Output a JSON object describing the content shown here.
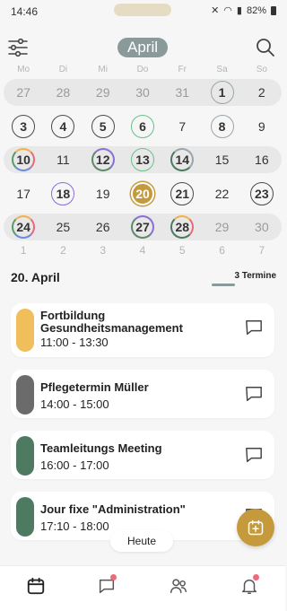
{
  "status": {
    "time": "14:46",
    "battery": "82%"
  },
  "header": {
    "month": "April"
  },
  "weekdays": [
    "Mo",
    "Di",
    "Mi",
    "Do",
    "Fr",
    "Sa",
    "So"
  ],
  "weeks": [
    [
      {
        "d": "27",
        "s": "other"
      },
      {
        "d": "28",
        "s": "other"
      },
      {
        "d": "29",
        "s": "other"
      },
      {
        "d": "30",
        "s": "other"
      },
      {
        "d": "31",
        "s": "other"
      },
      {
        "d": "1",
        "s": "ring-gray"
      },
      {
        "d": "2",
        "s": ""
      }
    ],
    [
      {
        "d": "3",
        "s": "ring-dark"
      },
      {
        "d": "4",
        "s": "ring-dark"
      },
      {
        "d": "5",
        "s": "ring-dark"
      },
      {
        "d": "6",
        "s": "ring-green"
      },
      {
        "d": "7",
        "s": ""
      },
      {
        "d": "8",
        "s": "ring-gray"
      },
      {
        "d": "9",
        "s": ""
      }
    ],
    [
      {
        "d": "10",
        "s": "ring-multi"
      },
      {
        "d": "11",
        "s": ""
      },
      {
        "d": "12",
        "s": "ring-dualpg"
      },
      {
        "d": "13",
        "s": "ring-green"
      },
      {
        "d": "14",
        "s": "ring-gray-green"
      },
      {
        "d": "15",
        "s": ""
      },
      {
        "d": "16",
        "s": ""
      }
    ],
    [
      {
        "d": "17",
        "s": ""
      },
      {
        "d": "18",
        "s": "ring-purple"
      },
      {
        "d": "19",
        "s": ""
      },
      {
        "d": "20",
        "s": "today"
      },
      {
        "d": "21",
        "s": "ring-dark"
      },
      {
        "d": "22",
        "s": ""
      },
      {
        "d": "23",
        "s": "ring-dark"
      }
    ],
    [
      {
        "d": "24",
        "s": "ring-multi"
      },
      {
        "d": "25",
        "s": ""
      },
      {
        "d": "26",
        "s": ""
      },
      {
        "d": "27",
        "s": "ring-dualpg"
      },
      {
        "d": "28",
        "s": "ring-og"
      },
      {
        "d": "29",
        "s": "other"
      },
      {
        "d": "30",
        "s": "other"
      }
    ]
  ],
  "weeknums": [
    "1",
    "2",
    "3",
    "4",
    "5",
    "6",
    "7"
  ],
  "selected": {
    "date": "20. April",
    "count": "3 Termine"
  },
  "events": [
    {
      "title": "Fortbildung Gesundheitsmanagement",
      "time": "11:00 - 13:30",
      "color": "#f0be5a"
    },
    {
      "title": "Pflegetermin Müller",
      "time": "14:00 - 15:00",
      "color": "#6b6b6b"
    },
    {
      "title": "Teamleitungs Meeting",
      "time": "16:00 - 17:00",
      "color": "#4f7a62"
    },
    {
      "title": "Jour fixe \"Administration\"",
      "time": "17:10 - 18:00",
      "color": "#4f7a62"
    }
  ],
  "today_button": "Heute",
  "accent": "#c59a3c",
  "nav": [
    {
      "icon": "calendar-icon",
      "badge": false
    },
    {
      "icon": "chat-icon",
      "badge": true
    },
    {
      "icon": "people-icon",
      "badge": false
    },
    {
      "icon": "bell-icon",
      "badge": true
    }
  ]
}
